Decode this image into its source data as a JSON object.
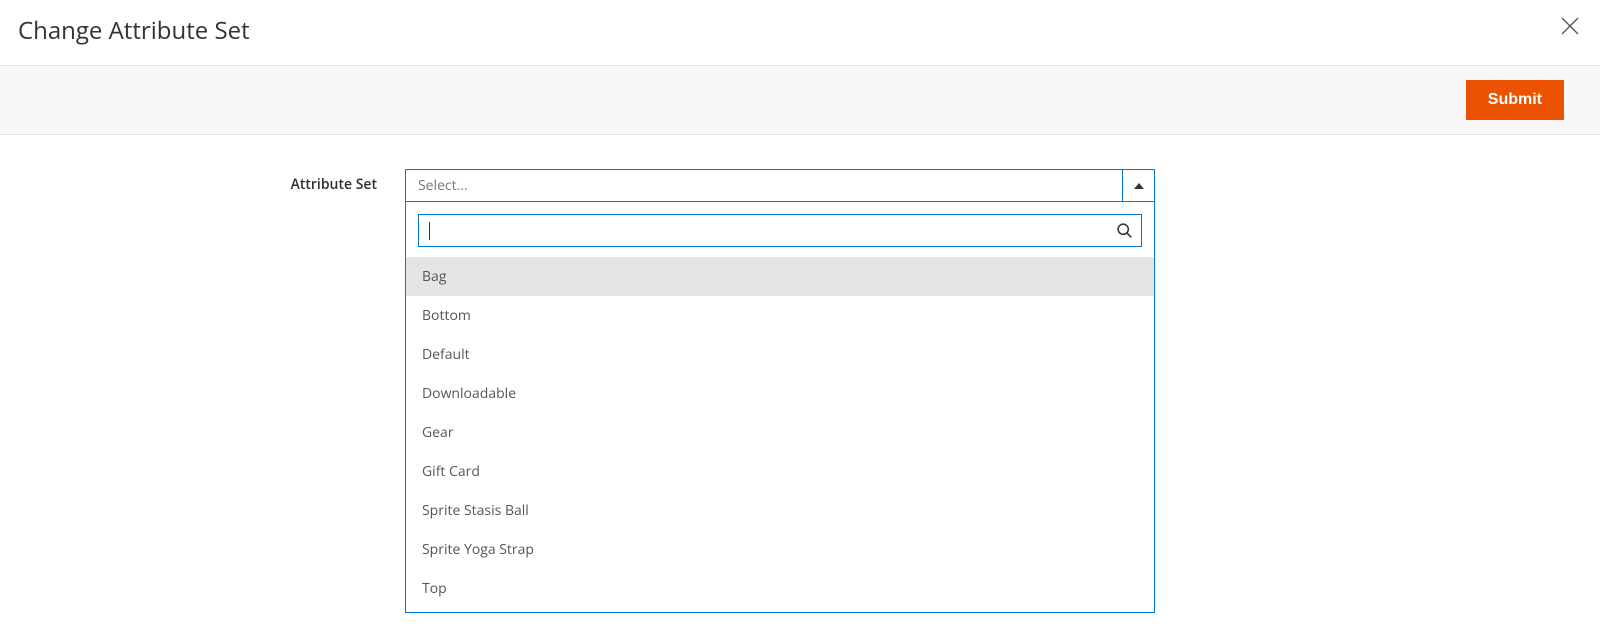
{
  "header": {
    "title": "Change Attribute Set"
  },
  "actions": {
    "submit_label": "Submit"
  },
  "form": {
    "attribute_set_label": "Attribute Set",
    "select_placeholder": "Select...",
    "search_placeholder": ""
  },
  "options": [
    {
      "label": "Bag",
      "highlighted": true
    },
    {
      "label": "Bottom",
      "highlighted": false
    },
    {
      "label": "Default",
      "highlighted": false
    },
    {
      "label": "Downloadable",
      "highlighted": false
    },
    {
      "label": "Gear",
      "highlighted": false
    },
    {
      "label": "Gift Card",
      "highlighted": false
    },
    {
      "label": "Sprite Stasis Ball",
      "highlighted": false
    },
    {
      "label": "Sprite Yoga Strap",
      "highlighted": false
    },
    {
      "label": "Top",
      "highlighted": false
    }
  ]
}
